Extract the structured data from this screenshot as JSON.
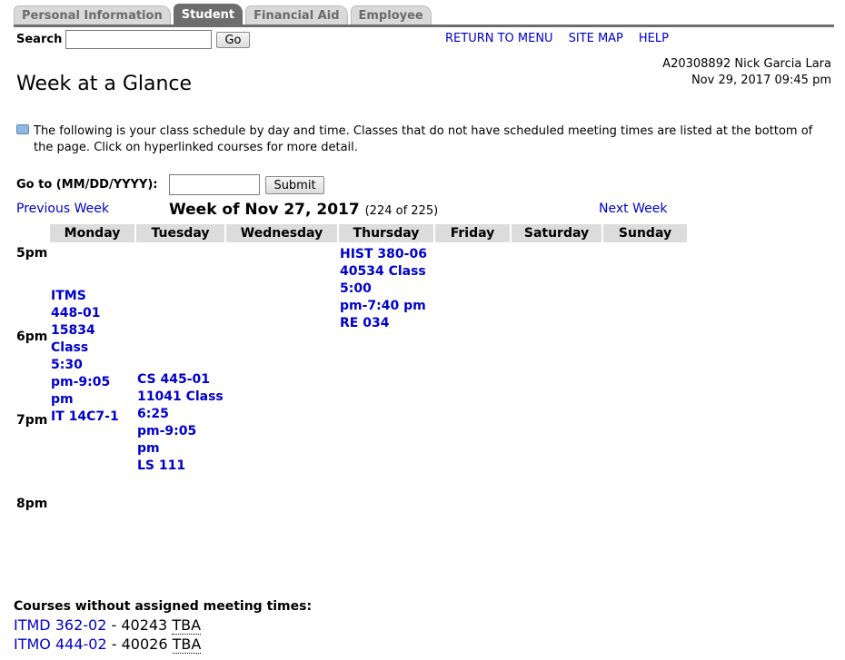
{
  "tabs": [
    "Personal Information",
    "Student",
    "Financial Aid",
    "Employee"
  ],
  "search": {
    "label": "Search",
    "value": "",
    "go_label": "Go"
  },
  "top_links": [
    "RETURN TO MENU",
    "SITE MAP",
    "HELP"
  ],
  "user": {
    "id_name": "A20308892 Nick Garcia Lara",
    "datetime": "Nov 29, 2017 09:45 pm"
  },
  "page_title": "Week at a Glance",
  "info_text": "The following is your class schedule by day and time. Classes that do not have scheduled meeting times are listed at the bottom of the page. Click on hyperlinked courses for more detail.",
  "goto": {
    "label": "Go to (MM/DD/YYYY):",
    "value": "",
    "submit_label": "Submit"
  },
  "week_nav": {
    "prev": "Previous Week",
    "title": "Week of Nov 27, 2017",
    "count": "(224 of 225)",
    "next": "Next Week"
  },
  "days": [
    "Monday",
    "Tuesday",
    "Wednesday",
    "Thursday",
    "Friday",
    "Saturday",
    "Sunday"
  ],
  "hours": [
    "5pm",
    "6pm",
    "7pm",
    "8pm"
  ],
  "courses": {
    "monday": [
      "ITMS",
      "448-01",
      "15834",
      "Class",
      "5:30",
      "pm-9:05",
      "pm",
      "IT 14C7-1"
    ],
    "tuesday": [
      "CS 445-01",
      "11041 Class",
      "6:25",
      "pm-9:05",
      "pm",
      "LS 111"
    ],
    "thursday": [
      "HIST 380-06",
      "40534 Class",
      "5:00",
      "pm-7:40 pm",
      "RE 034"
    ]
  },
  "unassigned": {
    "title": "Courses without assigned meeting times:",
    "items": [
      {
        "course": "ITMD 362-02",
        "crn": "40243",
        "tba": "TBA"
      },
      {
        "course": "ITMO 444-02",
        "crn": "40026",
        "tba": "TBA"
      }
    ]
  },
  "colors": {
    "link": "#0000cc",
    "tab_active": "#6d6d6d",
    "tab_inactive": "#d9d9d9",
    "header_bg": "#dcdcdc"
  }
}
